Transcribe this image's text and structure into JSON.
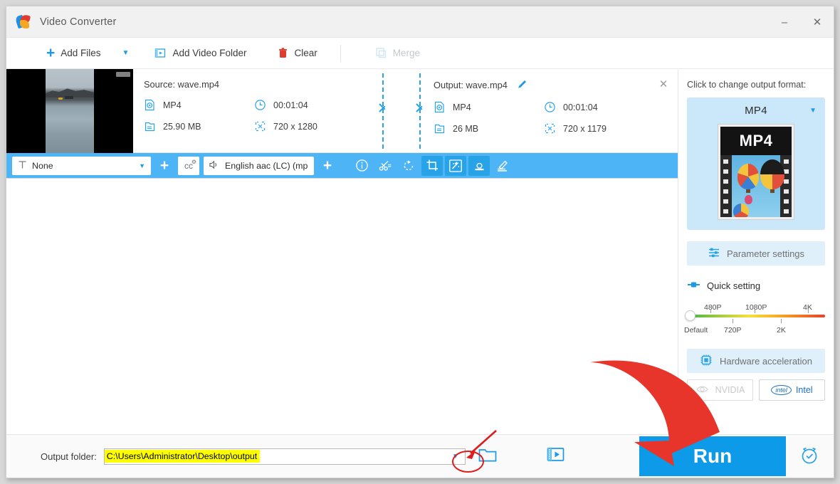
{
  "window": {
    "title": "Video Converter",
    "logo_icon": "video-converter-logo",
    "minimize_label": "–",
    "close_label": "✕"
  },
  "menubar": {
    "items": [
      {
        "label": "Add Files",
        "icon": "plus-icon",
        "enabled": true
      },
      {
        "label": "Add Video Folder",
        "icon": "video-folder-icon",
        "enabled": true
      },
      {
        "label": "Clear",
        "icon": "trash-icon",
        "enabled": true
      },
      {
        "label": "Merge",
        "icon": "merge-icon",
        "enabled": false
      }
    ],
    "dropdown_caret": "▼"
  },
  "file_card": {
    "thumbnail_alt": "sea-video-thumbnail",
    "close_label": "✕",
    "source": {
      "title": "Source: wave.mp4",
      "format": "MP4",
      "duration": "00:01:04",
      "size": "25.90 MB",
      "resolution": "720 x 1280"
    },
    "output": {
      "title": "Output: wave.mp4",
      "edit_icon": "pencil-icon",
      "format": "MP4",
      "duration": "00:01:04",
      "size": "26 MB",
      "resolution": "720 x 1179"
    }
  },
  "track_bar": {
    "subtitle_value": "None",
    "subtitle_icon": "subtitle-T-icon",
    "subtitle_add_label": "+",
    "cc_label": "cc",
    "audio_value": "English aac (LC) (mp",
    "audio_icon": "speaker-icon",
    "audio_add_label": "+",
    "caret": "▼",
    "tools": [
      {
        "name": "info-icon",
        "active": false
      },
      {
        "name": "scissors-cut-icon",
        "active": false
      },
      {
        "name": "rotate-icon",
        "active": false
      },
      {
        "name": "crop-icon",
        "active": true
      },
      {
        "name": "effects-wand-icon",
        "active": true
      },
      {
        "name": "watermark-stamp-icon",
        "active": true
      },
      {
        "name": "subtitle-edit-icon",
        "active": false
      }
    ]
  },
  "right_panel": {
    "header": "Click to change output format:",
    "format_name": "MP4",
    "format_caret": "▼",
    "format_thumb_label": "MP4",
    "parameter_settings": "Parameter settings",
    "parameter_icon": "sliders-icon",
    "quick_setting": "Quick setting",
    "quick_setting_icon": "toggle-icon",
    "quality_slider": {
      "top_labels": [
        "480P",
        "1080P",
        "4K"
      ],
      "bottom_labels": [
        "Default",
        "720P",
        "2K"
      ],
      "value": "Default",
      "position_percent": 0
    },
    "hardware_acceleration": "Hardware acceleration",
    "hardware_icon": "cpu-chip-icon",
    "gpus": [
      {
        "label": "NVIDIA",
        "icon": "nvidia-icon",
        "enabled": false
      },
      {
        "label": "Intel",
        "icon": "intel-icon",
        "enabled": true
      }
    ]
  },
  "bottom_bar": {
    "output_folder_label": "Output folder:",
    "output_folder_path": "C:\\Users\\Administrator\\Desktop\\output",
    "path_caret": "▼",
    "folder_icon": "open-folder-icon",
    "movie_icon": "output-preview-icon",
    "run_label": "Run",
    "alarm_icon": "alarm-clock-icon"
  },
  "annotations": {
    "highlight_circle": "red-ellipse-on-path-dropdown",
    "arrow_small": "red-arrow-to-path-dropdown",
    "arrow_large": "red-arrow-to-run-button",
    "color": "#e01b1b"
  }
}
